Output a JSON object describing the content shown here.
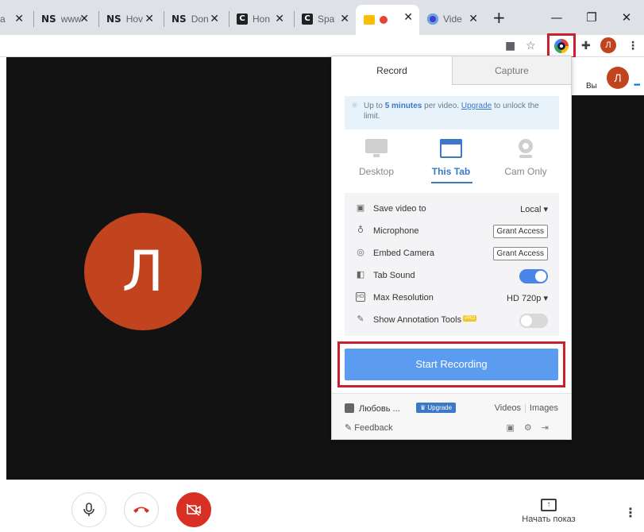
{
  "browser": {
    "tabs": [
      {
        "icon": "",
        "title": "a"
      },
      {
        "icon": "NS",
        "title": "www"
      },
      {
        "icon": "NS",
        "title": "Hov"
      },
      {
        "icon": "NS",
        "title": "Don"
      },
      {
        "icon": "C",
        "title": "Hon"
      },
      {
        "icon": "C",
        "title": "Spa"
      },
      {
        "icon": "",
        "title": ""
      },
      {
        "icon": "",
        "title": "Vide"
      }
    ],
    "close_glyph": "✕",
    "new_tab_glyph": "+",
    "window": {
      "minimize": "—",
      "restore": "❐",
      "close": "✕"
    },
    "profile_initial": "Л"
  },
  "meet": {
    "main_avatar_initial": "Л",
    "self_label": "Вы",
    "self_avatar_initial": "Л",
    "self_dots": "•••",
    "present_label": "Начать показ",
    "present_icon": "↑",
    "kebab": "⋮"
  },
  "popup": {
    "tabs": {
      "record": "Record",
      "capture": "Capture"
    },
    "banner": {
      "prefix": "Up to ",
      "bold": "5 minutes",
      "mid": " per video. ",
      "link": "Upgrade",
      "suffix": " to unlock the limit."
    },
    "modes": [
      {
        "label": "Desktop"
      },
      {
        "label": "This Tab"
      },
      {
        "label": "Cam Only"
      }
    ],
    "settings": {
      "save_video_to": {
        "label": "Save video to",
        "value": "Local ▾"
      },
      "microphone": {
        "label": "Microphone",
        "button": "Grant Access"
      },
      "embed_camera": {
        "label": "Embed Camera",
        "button": "Grant Access"
      },
      "tab_sound": {
        "label": "Tab Sound",
        "enabled": true
      },
      "max_resolution": {
        "label": "Max Resolution",
        "value": "HD 720p ▾"
      },
      "annotation": {
        "label": "Show Annotation Tools",
        "badge": "PRO",
        "enabled": false
      }
    },
    "start_label": "Start Recording",
    "footer": {
      "user_name": "Любовь ...",
      "upgrade": "♛ Upgrade",
      "videos": "Videos",
      "sep": "|",
      "images": "Images",
      "feedback": "Feedback"
    }
  },
  "colors": {
    "highlight": "#c8232c",
    "accent": "#3b78c6",
    "button": "#5b9bf0",
    "avatar": "#c1441f",
    "hangup": "#d93025"
  }
}
